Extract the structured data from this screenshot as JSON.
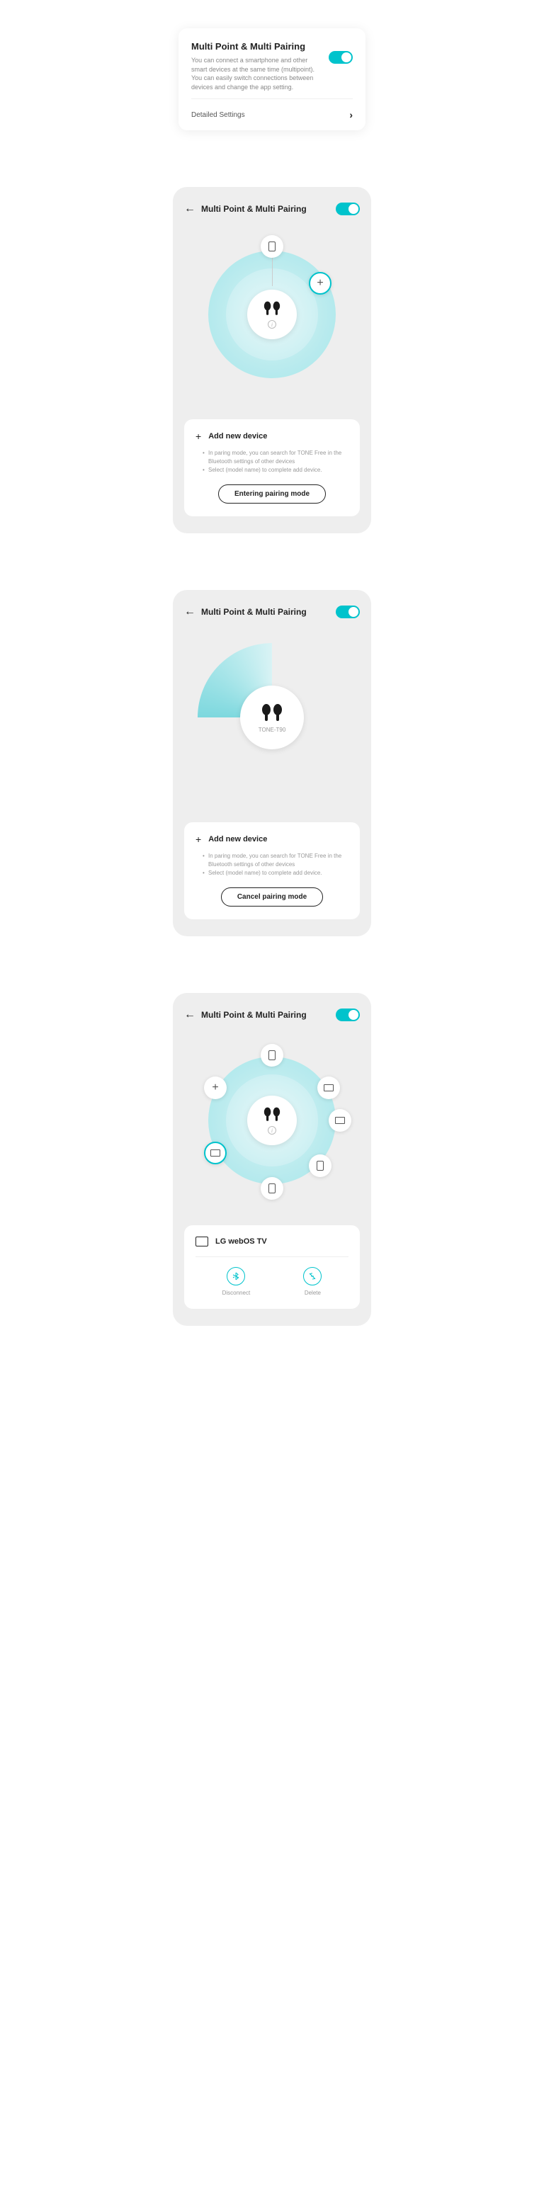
{
  "card1": {
    "title": "Multi Point & Multi Pairing",
    "desc": "You can connect a smartphone and other smart devices at the same time (multipoint). You can easily switch connections between devices and change the app setting.",
    "detail": "Detailed Settings"
  },
  "screen2": {
    "title": "Multi Point & Multi Pairing",
    "panel_title": "Add new device",
    "bullets": [
      "In paring mode, you can search for TONE Free in the Bluetooth settings of other devices",
      "Select (model name) to complete add device."
    ],
    "button": "Entering pairing mode"
  },
  "screen3": {
    "title": "Multi Point & Multi Pairing",
    "device_label": "TONE-T90",
    "panel_title": "Add new device",
    "bullets": [
      "In paring mode, you can search for TONE Free in the Bluetooth settings of other devices",
      "Select (model name) to complete add device."
    ],
    "button": "Cancel pairing mode"
  },
  "screen4": {
    "title": "Multi Point & Multi Pairing",
    "device_name": "LG webOS TV",
    "actions": {
      "disconnect": "Disconnect",
      "delete": "Delete"
    }
  }
}
